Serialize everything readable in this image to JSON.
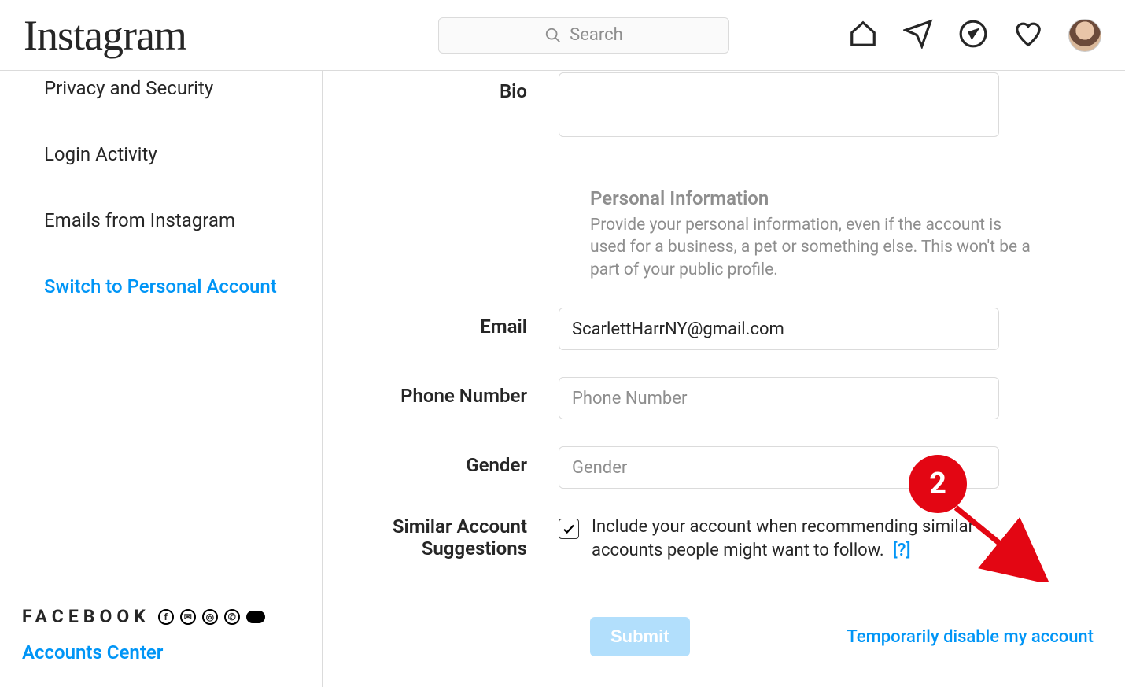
{
  "header": {
    "logo_text": "Instagram",
    "search_placeholder": "Search"
  },
  "sidebar": {
    "items": [
      {
        "label": "Privacy and Security",
        "link": false
      },
      {
        "label": "Login Activity",
        "link": false
      },
      {
        "label": "Emails from Instagram",
        "link": false
      },
      {
        "label": "Switch to Personal Account",
        "link": true
      }
    ],
    "footer": {
      "brand": "FACEBOOK",
      "accounts_center": "Accounts Center"
    }
  },
  "form": {
    "bio": {
      "label": "Bio",
      "value": ""
    },
    "personal_info": {
      "heading": "Personal Information",
      "desc": "Provide your personal information, even if the account is used for a business, a pet or something else. This won't be a part of your public profile."
    },
    "email": {
      "label": "Email",
      "value": "ScarlettHarrNY@gmail.com"
    },
    "phone": {
      "label": "Phone Number",
      "value": "",
      "placeholder": "Phone Number"
    },
    "gender": {
      "label": "Gender",
      "value": "",
      "placeholder": "Gender"
    },
    "similar": {
      "label": "Similar Account Suggestions",
      "checkbox_label": "Include your account when recommending similar accounts people might want to follow.",
      "help": "[?]",
      "checked": true
    },
    "submit_label": "Submit",
    "disable_link": "Temporarily disable my account"
  },
  "annotation": {
    "badge": "2"
  }
}
